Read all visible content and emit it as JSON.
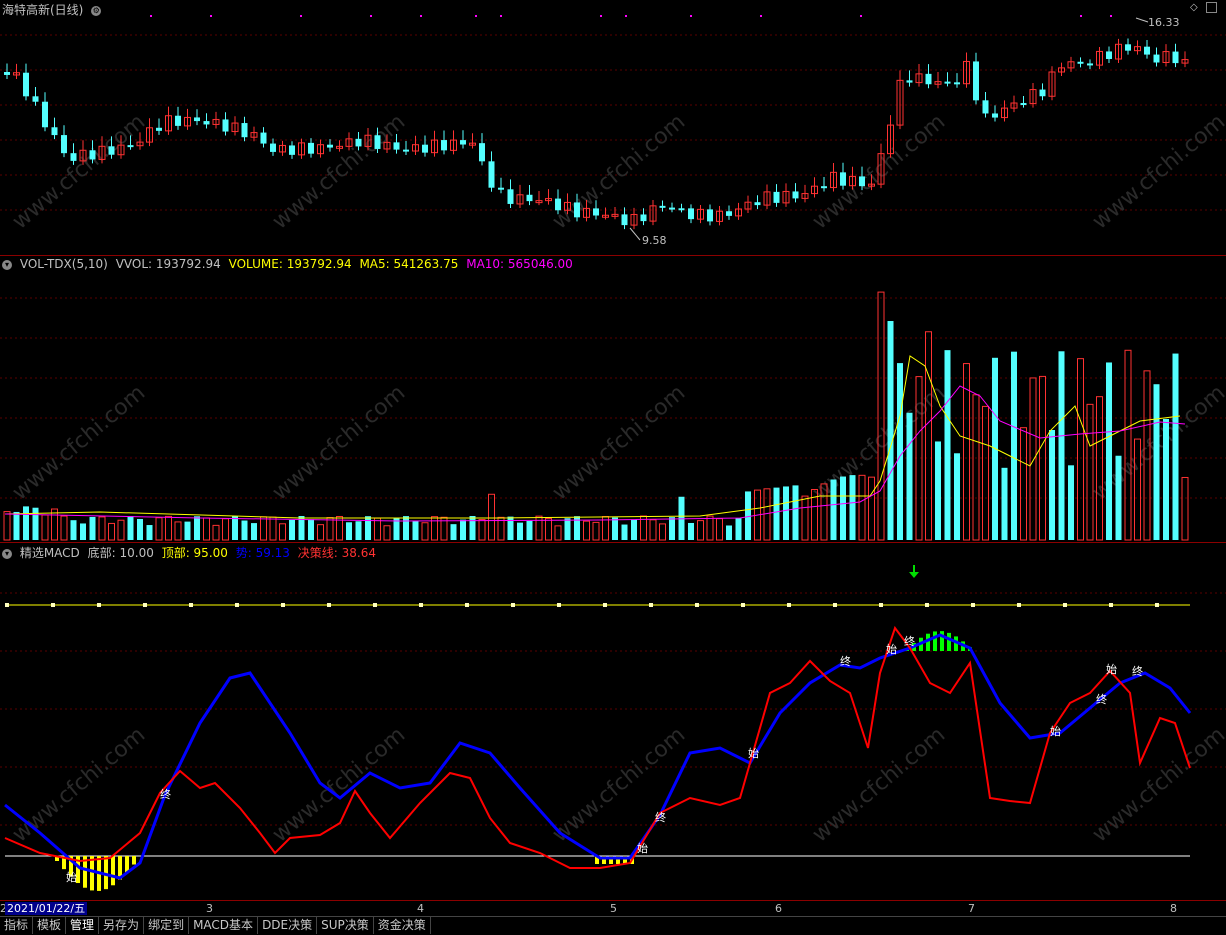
{
  "main_panel": {
    "title": "海特高新(日线)",
    "high_label": "16.33",
    "low_label": "9.58"
  },
  "vol_panel": {
    "name": "VOL-TDX(5,10)",
    "vvol": "VVOL: 193792.94",
    "volume": "VOLUME: 193792.94",
    "ma5": "MA5: 541263.75",
    "ma10": "MA10: 565046.00"
  },
  "macd_panel": {
    "name": "精选MACD",
    "bottom": "底部: 10.00",
    "top": "顶部: 95.00",
    "trend": "势: 59.13",
    "decision": "决策线: 38.64",
    "mark_start": "始",
    "mark_end": "终"
  },
  "xaxis": {
    "date_box": "2021/01/22/五",
    "prefix": "2",
    "months": [
      "3",
      "4",
      "5",
      "6",
      "7",
      "8"
    ]
  },
  "tabs": [
    "指标",
    "模板",
    "管理",
    "另存为",
    "绑定到",
    "MACD基本",
    "DDE决策",
    "SUP决策",
    "资金决策"
  ],
  "watermark": "www.cfchi.com",
  "colors": {
    "up": "#ff3232",
    "down": "#54ffff",
    "ma5": "#ffff00",
    "ma10": "#ff00ff",
    "trend": "#0000ff",
    "decision": "#ff0000"
  }
}
